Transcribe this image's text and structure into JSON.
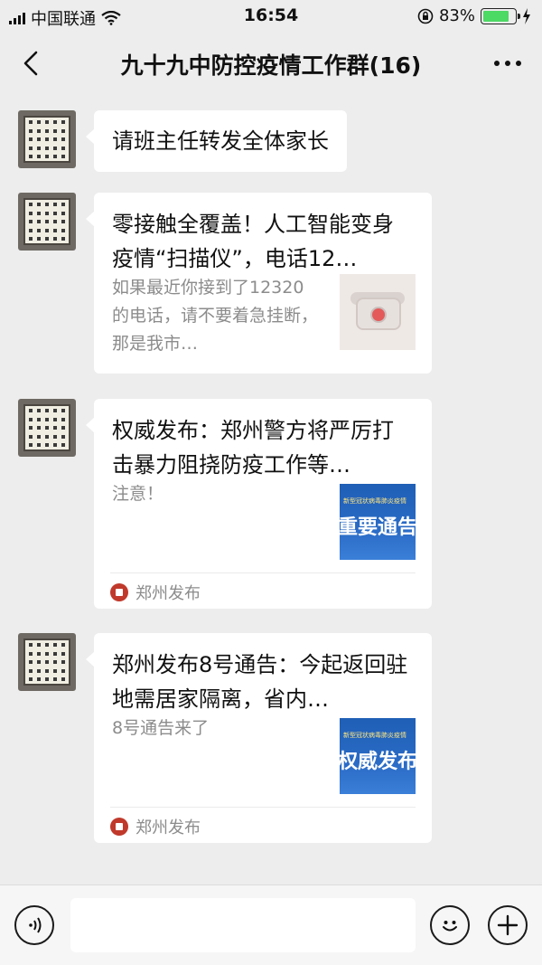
{
  "status_bar": {
    "carrier": "中国联通",
    "time": "16:54",
    "battery_percent": "83%",
    "battery_level": 0.83
  },
  "nav": {
    "title": "九十九中防控疫情工作群(16)",
    "back_icon": "chevron-left-icon",
    "more_icon": "more-dots-icon"
  },
  "messages": [
    {
      "type": "text",
      "text": "请班主任转发全体家长"
    },
    {
      "type": "card",
      "title": "零接触全覆盖！人工智能变身疫情“扫描仪”，电话12…",
      "description": "如果最近你接到了12320的电话，请不要着急挂断，那是我市…",
      "thumbnail": "phone-image"
    },
    {
      "type": "card",
      "title": "权威发布：郑州警方将严厉打击暴力阻挠防疫工作等…",
      "description": "注意！",
      "thumbnail_heading": "新型冠状病毒肺炎疫情",
      "thumbnail_text": "重要通告",
      "source": "郑州发布"
    },
    {
      "type": "card",
      "title": "郑州发布8号通告：今起返回驻地需居家隔离，省内…",
      "description": "8号通告来了",
      "thumbnail_heading": "新型冠状病毒肺炎疫情",
      "thumbnail_text": "权威发布",
      "source": "郑州发布"
    }
  ],
  "input_bar": {
    "voice_icon": "voice-icon",
    "emoji_icon": "emoji-icon",
    "plus_icon": "plus-icon",
    "input_value": ""
  },
  "colors": {
    "background": "#ededed",
    "bubble": "#ffffff",
    "muted_text": "#8c8c8c",
    "battery": "#4cd964"
  }
}
